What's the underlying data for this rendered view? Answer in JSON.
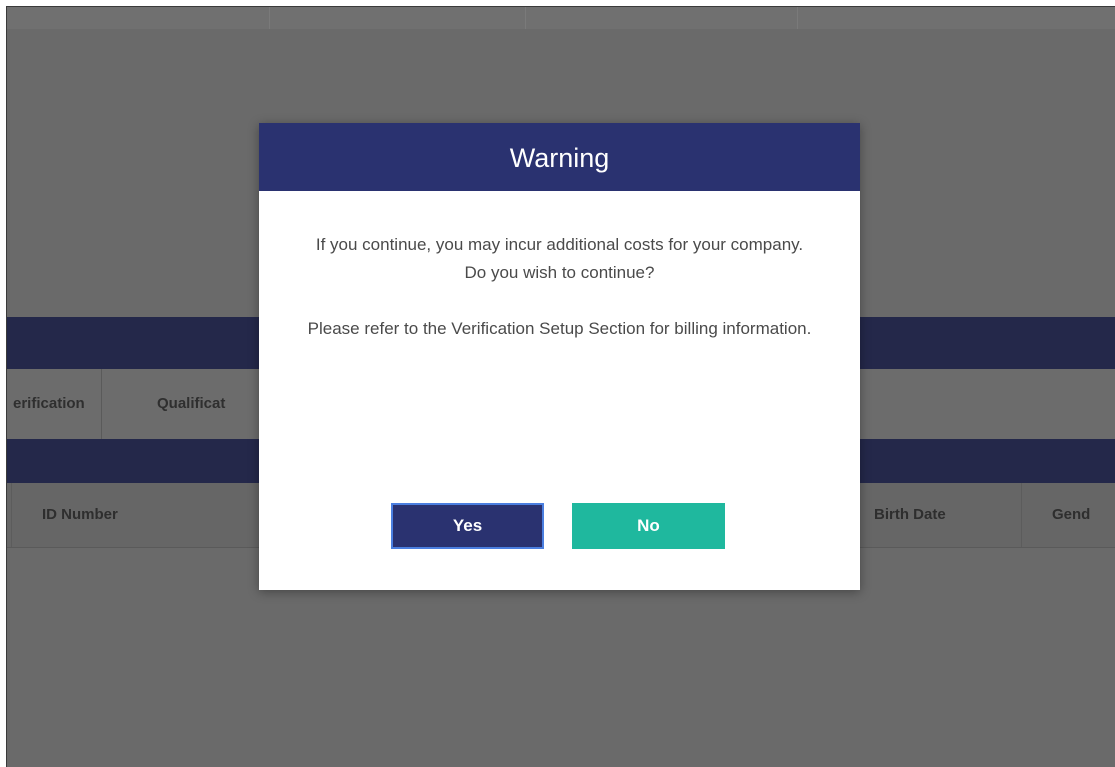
{
  "background": {
    "tabs": [
      "erification",
      "Qualificat"
    ],
    "table_headers": [
      "ID Number",
      "Birth Date",
      "Gend"
    ]
  },
  "modal": {
    "title": "Warning",
    "message_line1": "If you continue, you may incur additional costs for your company.",
    "message_line2": "Do you wish to continue?",
    "message_line3": "Please refer to the Verification Setup Section for billing information.",
    "yes_label": "Yes",
    "no_label": "No"
  },
  "colors": {
    "header_navy": "#2a3270",
    "no_button_teal": "#1fb89e",
    "yes_focus_border": "#4b7fe0"
  }
}
